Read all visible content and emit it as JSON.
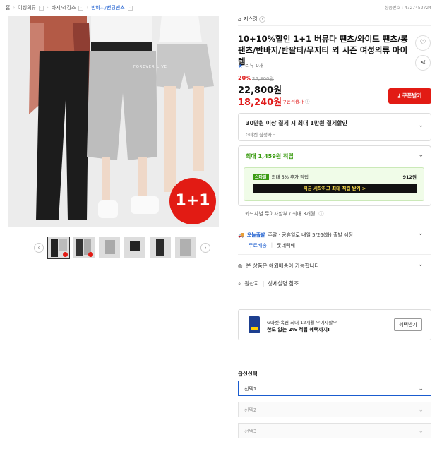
{
  "breadcrumb": {
    "home": "홈",
    "items": [
      "여성의류",
      "바지/레깅스",
      "반바지/밴딩팬츠"
    ]
  },
  "product_code": "상품번호 : 4727452724",
  "seller": {
    "name": "저스킷",
    "chevron": "›"
  },
  "hero_badge": "1+1",
  "hero_label": "FOREVER LIVE",
  "title": "10+10%할인 1+1 버뮤다 팬츠/와이드 팬츠/롱팬츠/반바지/반팔티/무지티 외 시즌 여성의류 아이템",
  "rating": {
    "star": "★",
    "text": "리뷰 0개"
  },
  "discount": "20%",
  "original_price": "22,800원",
  "price": "22,800원",
  "coupon_price": "18,240원",
  "coupon_price_tag": "쿠폰적용가",
  "coupon_button": "쿠폰받기",
  "card_offer": {
    "title": "30만원 이상 결제 시 최대 1만원 결제할인",
    "sub": "G마켓 삼성카드"
  },
  "points": {
    "title": "최대 1,459원 적립",
    "promo_badge": "스마일",
    "promo_text": "최대 5% 추가 적립",
    "promo_amount": "912원",
    "promo_cta": "지금 시작하고 최대 적립 받기 >"
  },
  "installment": "카드사별 무이자할부 / 최대 3개월",
  "delivery": {
    "badge": "오늘출발",
    "text": "주말 · 공휴일로 내일 5/26(화) 출발 예정",
    "free": "무료배송",
    "courier": "롯데택배"
  },
  "overseas": "본 상품은 해외배송이 가능합니다",
  "origin": {
    "label": "원산지",
    "value": "상세설명 참조"
  },
  "ad": {
    "line1": "G마켓·옥션 최대 12개월 무이자할부",
    "line2": "한도 없는 2% 적립 혜택까지!",
    "button": "혜택받기"
  },
  "options": {
    "header": "옵션선택",
    "items": [
      "선택1",
      "선택2",
      "선택3"
    ]
  },
  "colors": {
    "red": "#e21b14",
    "blue": "#1a5ccf",
    "green": "#3b9c12"
  }
}
